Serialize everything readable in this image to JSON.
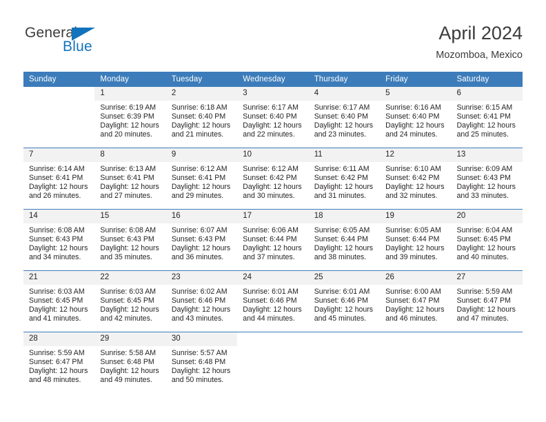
{
  "brand": {
    "name_part1": "General",
    "name_part2": "Blue",
    "triangle_icon": "triangle-icon",
    "accent_color": "#1273bd"
  },
  "header": {
    "title": "April 2024",
    "subtitle": "Mozomboa, Mexico",
    "header_bg_color": "#3c7cba",
    "daynum_bg_color": "#f2f2f2"
  },
  "weekdays": [
    "Sunday",
    "Monday",
    "Tuesday",
    "Wednesday",
    "Thursday",
    "Friday",
    "Saturday"
  ],
  "weeks": [
    {
      "days": [
        {
          "num": "",
          "sunrise": "",
          "sunset": "",
          "daylight_line1": "",
          "daylight_line2": "",
          "empty": true
        },
        {
          "num": "1",
          "sunrise": "Sunrise: 6:19 AM",
          "sunset": "Sunset: 6:39 PM",
          "daylight_line1": "Daylight: 12 hours",
          "daylight_line2": "and 20 minutes.",
          "empty": false
        },
        {
          "num": "2",
          "sunrise": "Sunrise: 6:18 AM",
          "sunset": "Sunset: 6:40 PM",
          "daylight_line1": "Daylight: 12 hours",
          "daylight_line2": "and 21 minutes.",
          "empty": false
        },
        {
          "num": "3",
          "sunrise": "Sunrise: 6:17 AM",
          "sunset": "Sunset: 6:40 PM",
          "daylight_line1": "Daylight: 12 hours",
          "daylight_line2": "and 22 minutes.",
          "empty": false
        },
        {
          "num": "4",
          "sunrise": "Sunrise: 6:17 AM",
          "sunset": "Sunset: 6:40 PM",
          "daylight_line1": "Daylight: 12 hours",
          "daylight_line2": "and 23 minutes.",
          "empty": false
        },
        {
          "num": "5",
          "sunrise": "Sunrise: 6:16 AM",
          "sunset": "Sunset: 6:40 PM",
          "daylight_line1": "Daylight: 12 hours",
          "daylight_line2": "and 24 minutes.",
          "empty": false
        },
        {
          "num": "6",
          "sunrise": "Sunrise: 6:15 AM",
          "sunset": "Sunset: 6:41 PM",
          "daylight_line1": "Daylight: 12 hours",
          "daylight_line2": "and 25 minutes.",
          "empty": false
        }
      ]
    },
    {
      "days": [
        {
          "num": "7",
          "sunrise": "Sunrise: 6:14 AM",
          "sunset": "Sunset: 6:41 PM",
          "daylight_line1": "Daylight: 12 hours",
          "daylight_line2": "and 26 minutes.",
          "empty": false
        },
        {
          "num": "8",
          "sunrise": "Sunrise: 6:13 AM",
          "sunset": "Sunset: 6:41 PM",
          "daylight_line1": "Daylight: 12 hours",
          "daylight_line2": "and 27 minutes.",
          "empty": false
        },
        {
          "num": "9",
          "sunrise": "Sunrise: 6:12 AM",
          "sunset": "Sunset: 6:41 PM",
          "daylight_line1": "Daylight: 12 hours",
          "daylight_line2": "and 29 minutes.",
          "empty": false
        },
        {
          "num": "10",
          "sunrise": "Sunrise: 6:12 AM",
          "sunset": "Sunset: 6:42 PM",
          "daylight_line1": "Daylight: 12 hours",
          "daylight_line2": "and 30 minutes.",
          "empty": false
        },
        {
          "num": "11",
          "sunrise": "Sunrise: 6:11 AM",
          "sunset": "Sunset: 6:42 PM",
          "daylight_line1": "Daylight: 12 hours",
          "daylight_line2": "and 31 minutes.",
          "empty": false
        },
        {
          "num": "12",
          "sunrise": "Sunrise: 6:10 AM",
          "sunset": "Sunset: 6:42 PM",
          "daylight_line1": "Daylight: 12 hours",
          "daylight_line2": "and 32 minutes.",
          "empty": false
        },
        {
          "num": "13",
          "sunrise": "Sunrise: 6:09 AM",
          "sunset": "Sunset: 6:43 PM",
          "daylight_line1": "Daylight: 12 hours",
          "daylight_line2": "and 33 minutes.",
          "empty": false
        }
      ]
    },
    {
      "days": [
        {
          "num": "14",
          "sunrise": "Sunrise: 6:08 AM",
          "sunset": "Sunset: 6:43 PM",
          "daylight_line1": "Daylight: 12 hours",
          "daylight_line2": "and 34 minutes.",
          "empty": false
        },
        {
          "num": "15",
          "sunrise": "Sunrise: 6:08 AM",
          "sunset": "Sunset: 6:43 PM",
          "daylight_line1": "Daylight: 12 hours",
          "daylight_line2": "and 35 minutes.",
          "empty": false
        },
        {
          "num": "16",
          "sunrise": "Sunrise: 6:07 AM",
          "sunset": "Sunset: 6:43 PM",
          "daylight_line1": "Daylight: 12 hours",
          "daylight_line2": "and 36 minutes.",
          "empty": false
        },
        {
          "num": "17",
          "sunrise": "Sunrise: 6:06 AM",
          "sunset": "Sunset: 6:44 PM",
          "daylight_line1": "Daylight: 12 hours",
          "daylight_line2": "and 37 minutes.",
          "empty": false
        },
        {
          "num": "18",
          "sunrise": "Sunrise: 6:05 AM",
          "sunset": "Sunset: 6:44 PM",
          "daylight_line1": "Daylight: 12 hours",
          "daylight_line2": "and 38 minutes.",
          "empty": false
        },
        {
          "num": "19",
          "sunrise": "Sunrise: 6:05 AM",
          "sunset": "Sunset: 6:44 PM",
          "daylight_line1": "Daylight: 12 hours",
          "daylight_line2": "and 39 minutes.",
          "empty": false
        },
        {
          "num": "20",
          "sunrise": "Sunrise: 6:04 AM",
          "sunset": "Sunset: 6:45 PM",
          "daylight_line1": "Daylight: 12 hours",
          "daylight_line2": "and 40 minutes.",
          "empty": false
        }
      ]
    },
    {
      "days": [
        {
          "num": "21",
          "sunrise": "Sunrise: 6:03 AM",
          "sunset": "Sunset: 6:45 PM",
          "daylight_line1": "Daylight: 12 hours",
          "daylight_line2": "and 41 minutes.",
          "empty": false
        },
        {
          "num": "22",
          "sunrise": "Sunrise: 6:03 AM",
          "sunset": "Sunset: 6:45 PM",
          "daylight_line1": "Daylight: 12 hours",
          "daylight_line2": "and 42 minutes.",
          "empty": false
        },
        {
          "num": "23",
          "sunrise": "Sunrise: 6:02 AM",
          "sunset": "Sunset: 6:46 PM",
          "daylight_line1": "Daylight: 12 hours",
          "daylight_line2": "and 43 minutes.",
          "empty": false
        },
        {
          "num": "24",
          "sunrise": "Sunrise: 6:01 AM",
          "sunset": "Sunset: 6:46 PM",
          "daylight_line1": "Daylight: 12 hours",
          "daylight_line2": "and 44 minutes.",
          "empty": false
        },
        {
          "num": "25",
          "sunrise": "Sunrise: 6:01 AM",
          "sunset": "Sunset: 6:46 PM",
          "daylight_line1": "Daylight: 12 hours",
          "daylight_line2": "and 45 minutes.",
          "empty": false
        },
        {
          "num": "26",
          "sunrise": "Sunrise: 6:00 AM",
          "sunset": "Sunset: 6:47 PM",
          "daylight_line1": "Daylight: 12 hours",
          "daylight_line2": "and 46 minutes.",
          "empty": false
        },
        {
          "num": "27",
          "sunrise": "Sunrise: 5:59 AM",
          "sunset": "Sunset: 6:47 PM",
          "daylight_line1": "Daylight: 12 hours",
          "daylight_line2": "and 47 minutes.",
          "empty": false
        }
      ]
    },
    {
      "days": [
        {
          "num": "28",
          "sunrise": "Sunrise: 5:59 AM",
          "sunset": "Sunset: 6:47 PM",
          "daylight_line1": "Daylight: 12 hours",
          "daylight_line2": "and 48 minutes.",
          "empty": false
        },
        {
          "num": "29",
          "sunrise": "Sunrise: 5:58 AM",
          "sunset": "Sunset: 6:48 PM",
          "daylight_line1": "Daylight: 12 hours",
          "daylight_line2": "and 49 minutes.",
          "empty": false
        },
        {
          "num": "30",
          "sunrise": "Sunrise: 5:57 AM",
          "sunset": "Sunset: 6:48 PM",
          "daylight_line1": "Daylight: 12 hours",
          "daylight_line2": "and 50 minutes.",
          "empty": false
        },
        {
          "num": "",
          "sunrise": "",
          "sunset": "",
          "daylight_line1": "",
          "daylight_line2": "",
          "empty": true
        },
        {
          "num": "",
          "sunrise": "",
          "sunset": "",
          "daylight_line1": "",
          "daylight_line2": "",
          "empty": true
        },
        {
          "num": "",
          "sunrise": "",
          "sunset": "",
          "daylight_line1": "",
          "daylight_line2": "",
          "empty": true
        },
        {
          "num": "",
          "sunrise": "",
          "sunset": "",
          "daylight_line1": "",
          "daylight_line2": "",
          "empty": true
        }
      ]
    }
  ]
}
